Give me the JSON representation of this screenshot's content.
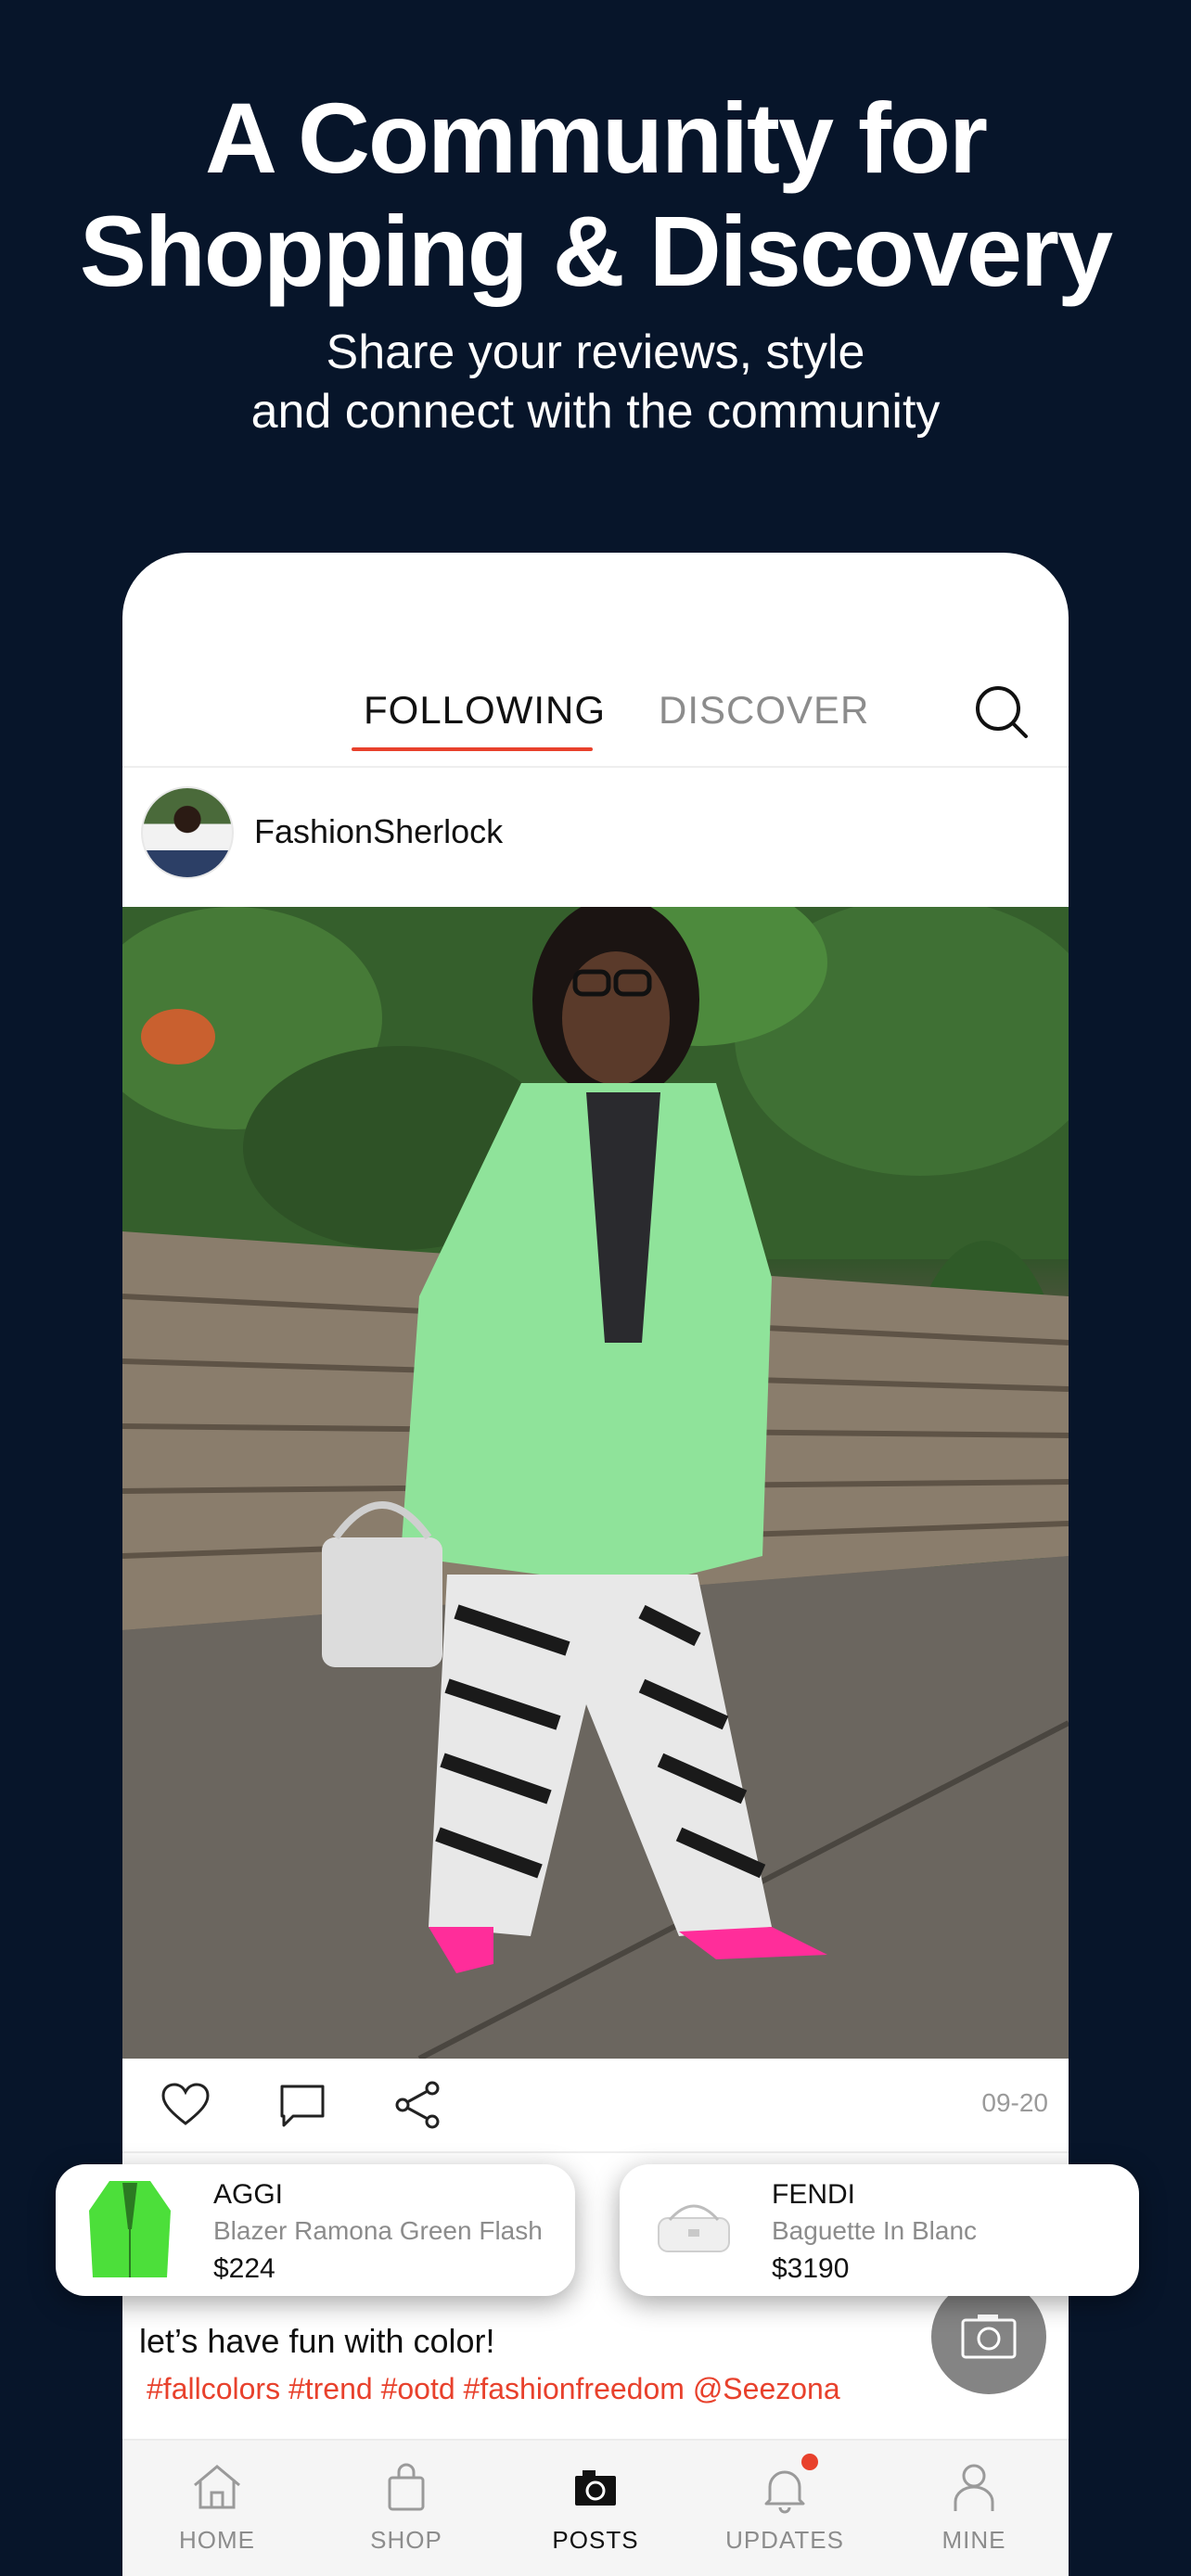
{
  "hero": {
    "title_line1": "A Community for",
    "title_line2": "Shopping & Discovery",
    "subtitle_line1": "Share your reviews, style",
    "subtitle_line2": "and connect with the community"
  },
  "tabs": {
    "following": "FOLLOWING",
    "discover": "DISCOVER",
    "active": "FOLLOWING"
  },
  "post": {
    "author": "FashionSherlock",
    "date": "09-20",
    "caption": "let’s have fun with color!",
    "tags": "#fallcolors #trend #ootd #fashionfreedom @Seezona"
  },
  "products": [
    {
      "brand": "AGGI",
      "name": "Blazer Ramona Green Flash",
      "price": "$224"
    },
    {
      "brand": "FENDI",
      "name": "Baguette In Blanc",
      "price": "$3190"
    }
  ],
  "nav": [
    {
      "label": "HOME",
      "icon": "home-icon"
    },
    {
      "label": "SHOP",
      "icon": "shopping-bag-icon"
    },
    {
      "label": "POSTS",
      "icon": "camera-icon"
    },
    {
      "label": "UPDATES",
      "icon": "bell-icon"
    },
    {
      "label": "MINE",
      "icon": "person-icon"
    }
  ],
  "colors": {
    "background": "#07152a",
    "accent": "#e8412c",
    "inactive": "#8c8c8c"
  }
}
